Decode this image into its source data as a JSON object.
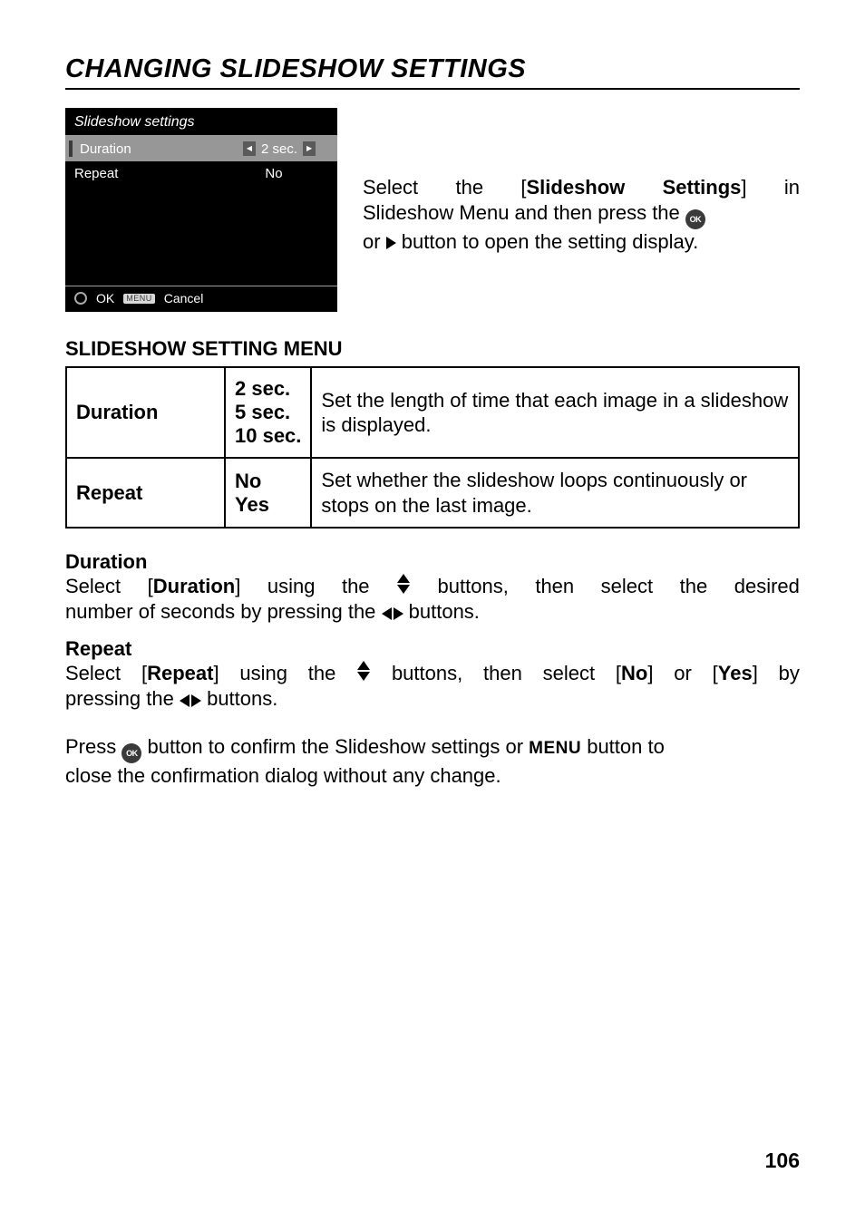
{
  "heading": "CHANGING SLIDESHOW SETTINGS",
  "camera_screen": {
    "title": "Slideshow settings",
    "rows": [
      {
        "label": "Duration",
        "value": "2 sec.",
        "selected": true
      },
      {
        "label": "Repeat",
        "value": "No",
        "selected": false
      }
    ],
    "footer": {
      "ok": "OK",
      "menu_box": "MENU",
      "cancel": "Cancel"
    }
  },
  "intro": {
    "line1": {
      "a": "Select",
      "b": "the",
      "c": "[",
      "d": "Slideshow",
      "e": "Settings",
      "f": "]",
      "g": "in"
    },
    "line2": "Slideshow Menu and then press the ",
    "line3_a": "or ",
    "line3_b": " button to open the setting display."
  },
  "submenu_heading": "SLIDESHOW SETTING MENU",
  "table": {
    "rows": [
      {
        "key": "Duration",
        "opts": [
          "2 sec.",
          "5 sec.",
          "10 sec."
        ],
        "desc": "Set the length of time that each image in a slideshow is displayed."
      },
      {
        "key": "Repeat",
        "opts": [
          "No",
          "Yes"
        ],
        "desc": "Set whether the slideshow loops continuously or stops on the last image."
      }
    ]
  },
  "duration_section": {
    "title": "Duration",
    "l1": {
      "a": "Select",
      "b": "[",
      "c": "Duration",
      "d": "]",
      "e": "using",
      "f": "the",
      "g": "buttons,",
      "h": "then",
      "i": "select",
      "j": "the",
      "k": "desired"
    },
    "l2_a": "number of seconds by pressing the ",
    "l2_b": " buttons."
  },
  "repeat_section": {
    "title": "Repeat",
    "l1": {
      "a": "Select",
      "b": "[",
      "c": "Repeat",
      "d": "]",
      "e": "using",
      "f": "the",
      "g": "buttons,",
      "h": "then",
      "i": "select",
      "j": "[",
      "k": "No",
      "l": "]",
      "m": "or",
      "n": "[",
      "o": "Yes",
      "p": "]",
      "q": "by"
    },
    "l2_a": "pressing the ",
    "l2_b": " buttons."
  },
  "confirm": {
    "a": "Press ",
    "b": " button to confirm the Slideshow settings or ",
    "menu_word": "MENU",
    "c": " button to",
    "d": "close the confirmation dialog without any change."
  },
  "page_number": "106"
}
